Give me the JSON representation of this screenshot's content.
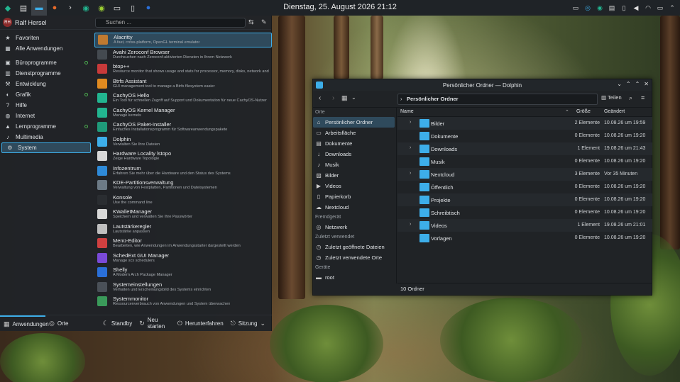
{
  "clock": "Dienstag, 25. August 2026 21:12",
  "user": {
    "name": "Ralf Hersel",
    "initials": "RH"
  },
  "search": {
    "placeholder": "Suchen ..."
  },
  "categories": [
    {
      "label": "Favoriten",
      "icon": "star-icon"
    },
    {
      "label": "Alle Anwendungen",
      "icon": "grid-icon"
    },
    {
      "label": "Büroprogramme",
      "icon": "briefcase-icon",
      "new": true
    },
    {
      "label": "Dienstprogramme",
      "icon": "toolbox-icon"
    },
    {
      "label": "Entwicklung",
      "icon": "wrench-icon"
    },
    {
      "label": "Grafik",
      "icon": "palette-icon",
      "new": true
    },
    {
      "label": "Hilfe",
      "icon": "help-icon"
    },
    {
      "label": "Internet",
      "icon": "globe-icon"
    },
    {
      "label": "Lernprogramme",
      "icon": "education-icon",
      "new": true
    },
    {
      "label": "Multimedia",
      "icon": "music-icon"
    },
    {
      "label": "System",
      "icon": "gear-icon",
      "selected": true
    }
  ],
  "apps": [
    {
      "name": "Alacritty",
      "desc": "A fast, cross-platform, OpenGL terminal emulator",
      "color": "#c07a30"
    },
    {
      "name": "Avahi Zeroconf Browser",
      "desc": "Durchsuchen nach Zeroconf-aktivierten Diensten in Ihrem Netzwerk",
      "color": "#444a50"
    },
    {
      "name": "btop++",
      "desc": "Resource monitor that shows usage and stats for processor, memory, disks, network and processes.",
      "color": "#c83a3a"
    },
    {
      "name": "Btrfs Assistant",
      "desc": "GUI management tool to manage a Btrfs filesystem easier",
      "color": "#e08a20"
    },
    {
      "name": "CachyOS Hello",
      "desc": "Ein Tool für schnellen Zugriff auf Support und Dokumentation für neue CachyOS-Nutzer",
      "color": "#22b590"
    },
    {
      "name": "CachyOS Kernel Manager",
      "desc": "Manage kernels",
      "color": "#22b590"
    },
    {
      "name": "CachyOS Paket-Installer",
      "desc": "Einfaches Installationsprogramm für Softwareanwendungspakete",
      "color": "#1f9a7a"
    },
    {
      "name": "Dolphin",
      "desc": "Verwalten Sie Ihre Dateien",
      "color": "#3daee9"
    },
    {
      "name": "Hardware Locality lstopo",
      "desc": "Zeige Hardware Topologie",
      "color": "#d8d8d8"
    },
    {
      "name": "Infozentrum",
      "desc": "Erfahren Sie mehr über die Hardware und den Status des Systems",
      "color": "#2e8ad8"
    },
    {
      "name": "KDE-Partitionsverwaltung",
      "desc": "Verwaltung von Festplatten, Partitionen und Dateisystemen",
      "color": "#6c7a86"
    },
    {
      "name": "Konsole",
      "desc": "Use the command line",
      "color": "#2a2d31"
    },
    {
      "name": "KWalletManager",
      "desc": "Speichern und verwalten Sie Ihre Passwörter",
      "color": "#d8d8d8"
    },
    {
      "name": "Lautstärkeregler",
      "desc": "Lautstärke anpassen",
      "color": "#bfbfbf"
    },
    {
      "name": "Menü-Editor",
      "desc": "Bearbeiten, wie Anwendungen im Anwendungsstarter dargestellt werden",
      "color": "#d04040"
    },
    {
      "name": "SchedExt GUI Manager",
      "desc": "Manage scx schedulers",
      "color": "#7a4ad8"
    },
    {
      "name": "Shelly",
      "desc": "A Modern Arch Package Manager",
      "color": "#2a6fd8"
    },
    {
      "name": "Systemeinstellungen",
      "desc": "Verhalten und Erscheinungsbild des Systems einrichten",
      "color": "#4a5058"
    },
    {
      "name": "Systemmonitor",
      "desc": "Ressourcenverbrauch von Anwendungen und System überwachen",
      "color": "#3a9a5a"
    }
  ],
  "footer": {
    "apps_tab": "Anwendungen",
    "places_tab": "Orte",
    "standby": "Standby",
    "restart": "Neu starten",
    "shutdown": "Herunterfahren",
    "session": "Sitzung"
  },
  "dolphin": {
    "title": "Persönlicher Ordner — Dolphin",
    "breadcrumb": "Persönlicher Ordner",
    "split": "Teilen",
    "places_header": "Orte",
    "places": [
      {
        "label": "Persönlicher Ordner",
        "icon": "home-icon",
        "selected": true
      },
      {
        "label": "Arbeitsfläche",
        "icon": "desktop-icon"
      },
      {
        "label": "Dokumente",
        "icon": "document-folder-icon"
      },
      {
        "label": "Downloads",
        "icon": "download-icon"
      },
      {
        "label": "Musik",
        "icon": "music-icon"
      },
      {
        "label": "Bilder",
        "icon": "image-icon"
      },
      {
        "label": "Videos",
        "icon": "video-icon"
      },
      {
        "label": "Papierkorb",
        "icon": "trash-icon"
      },
      {
        "label": "Nextcloud",
        "icon": "cloud-icon"
      }
    ],
    "remote_header": "Fremdgerät",
    "remote": [
      {
        "label": "Netzwerk",
        "icon": "network-icon"
      }
    ],
    "recent_header": "Zuletzt verwendet",
    "recent": [
      {
        "label": "Zuletzt geöffnete Dateien",
        "icon": "recent-files-icon"
      },
      {
        "label": "Zuletzt verwendete Orte",
        "icon": "recent-places-icon"
      }
    ],
    "devices_header": "Geräte",
    "devices": [
      {
        "label": "root",
        "icon": "drive-icon"
      }
    ],
    "columns": {
      "name": "Name",
      "size": "Größe",
      "modified": "Geändert"
    },
    "files": [
      {
        "name": "Bilder",
        "size": "2 Elemente",
        "modified": "10.08.26 um 19:59",
        "expandable": true
      },
      {
        "name": "Dokumente",
        "size": "0 Elemente",
        "modified": "10.08.26 um 19:20",
        "expandable": false
      },
      {
        "name": "Downloads",
        "size": "1 Element",
        "modified": "19.08.26 um 21:43",
        "expandable": true
      },
      {
        "name": "Musik",
        "size": "0 Elemente",
        "modified": "10.08.26 um 19:20",
        "expandable": false
      },
      {
        "name": "Nextcloud",
        "size": "3 Elemente",
        "modified": "Vor 35 Minuten",
        "expandable": true
      },
      {
        "name": "Öffentlich",
        "size": "0 Elemente",
        "modified": "10.08.26 um 19:20",
        "expandable": false
      },
      {
        "name": "Projekte",
        "size": "0 Elemente",
        "modified": "10.08.26 um 19:20",
        "expandable": false
      },
      {
        "name": "Schreibtisch",
        "size": "0 Elemente",
        "modified": "10.08.26 um 19:20",
        "expandable": false
      },
      {
        "name": "Videos",
        "size": "1 Element",
        "modified": "19.08.26 um 21:01",
        "expandable": true
      },
      {
        "name": "Vorlagen",
        "size": "0 Elemente",
        "modified": "10.08.26 um 19:20",
        "expandable": false
      }
    ],
    "status": "10 Ordner"
  },
  "colors": {
    "accent": "#3daee9",
    "panel": "#1f2327",
    "window": "#202326"
  }
}
